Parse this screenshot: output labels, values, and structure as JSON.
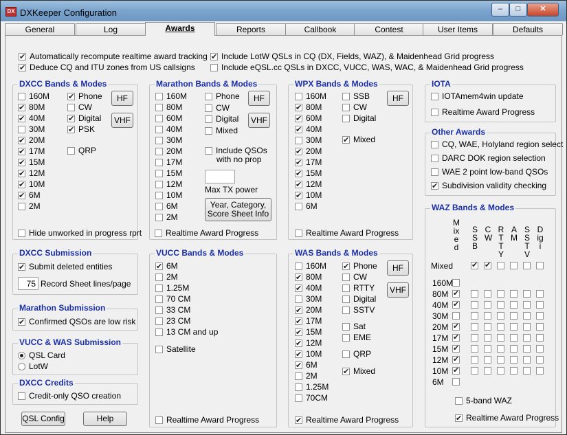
{
  "window": {
    "title": "DXKeeper Configuration"
  },
  "tabs": [
    "General",
    "Log",
    "Awards",
    "Reports",
    "Callbook",
    "Contest",
    "User Items",
    "Defaults"
  ],
  "top_options": {
    "auto_recompute": {
      "label": "Automatically recompute realtime award tracking",
      "checked": true
    },
    "deduce_cq": {
      "label": "Deduce CQ and ITU zones from US callsigns",
      "checked": true
    },
    "include_lotw": {
      "label": "Include LotW QSLs in CQ (DX, Fields, WAZ), & Maidenhead Grid progress",
      "checked": true
    },
    "include_eqsl": {
      "label": "Include eQSL.cc QSLs in DXCC, VUCC, WAS, WAC, & Maidenhead Grid progress",
      "checked": false
    }
  },
  "dxcc_bands": {
    "title": "DXCC Bands & Modes",
    "bands": [
      {
        "label": "160M",
        "checked": false
      },
      {
        "label": "80M",
        "checked": true
      },
      {
        "label": "40M",
        "checked": true
      },
      {
        "label": "30M",
        "checked": false
      },
      {
        "label": "20M",
        "checked": true
      },
      {
        "label": "17M",
        "checked": true
      },
      {
        "label": "15M",
        "checked": true
      },
      {
        "label": "12M",
        "checked": true
      },
      {
        "label": "10M",
        "checked": true
      },
      {
        "label": "6M",
        "checked": true
      },
      {
        "label": "2M",
        "checked": false
      }
    ],
    "modes": [
      {
        "label": "Phone",
        "checked": true
      },
      {
        "label": "CW",
        "checked": false
      },
      {
        "label": "Digital",
        "checked": true
      },
      {
        "label": "PSK",
        "checked": true
      }
    ],
    "qrp": {
      "label": "QRP",
      "checked": false
    },
    "hf": "HF",
    "vhf": "VHF",
    "hide_unworked": {
      "label": "Hide unworked in progress rprt",
      "checked": false
    }
  },
  "marathon_bands": {
    "title": "Marathon Bands & Modes",
    "bands": [
      {
        "label": "160M",
        "checked": false
      },
      {
        "label": "80M",
        "checked": false
      },
      {
        "label": "60M",
        "checked": false
      },
      {
        "label": "40M",
        "checked": false
      },
      {
        "label": "30M",
        "checked": false
      },
      {
        "label": "20M",
        "checked": false
      },
      {
        "label": "17M",
        "checked": false
      },
      {
        "label": "15M",
        "checked": false
      },
      {
        "label": "12M",
        "checked": false
      },
      {
        "label": "10M",
        "checked": false
      },
      {
        "label": "6M",
        "checked": false
      },
      {
        "label": "2M",
        "checked": false
      }
    ],
    "modes": [
      {
        "label": "Phone",
        "checked": false
      },
      {
        "label": "CW",
        "checked": false
      },
      {
        "label": "Digital",
        "checked": false
      },
      {
        "label": "Mixed",
        "checked": false
      }
    ],
    "include_qsos_line1": "Include QSOs",
    "include_qsos_line2": "with no prop",
    "include_qsos_checked": false,
    "max_tx_label": "Max TX power",
    "max_tx_value": "",
    "hf": "HF",
    "vhf": "VHF",
    "score_button_line1": "Year, Category,",
    "score_button_line2": "Score Sheet Info",
    "realtime": {
      "label": "Realtime Award Progress",
      "checked": false
    }
  },
  "wpx_bands": {
    "title": "WPX Bands & Modes",
    "bands": [
      {
        "label": "160M",
        "checked": false
      },
      {
        "label": "80M",
        "checked": true
      },
      {
        "label": "60M",
        "checked": true
      },
      {
        "label": "40M",
        "checked": true
      },
      {
        "label": "30M",
        "checked": false
      },
      {
        "label": "20M",
        "checked": true
      },
      {
        "label": "17M",
        "checked": true
      },
      {
        "label": "15M",
        "checked": true
      },
      {
        "label": "12M",
        "checked": true
      },
      {
        "label": "10M",
        "checked": true
      },
      {
        "label": "6M",
        "checked": false
      }
    ],
    "modes": [
      {
        "label": "SSB",
        "checked": false
      },
      {
        "label": "CW",
        "checked": false
      },
      {
        "label": "Digital",
        "checked": false
      }
    ],
    "mixed": {
      "label": "Mixed",
      "checked": true
    },
    "hf": "HF",
    "realtime": {
      "label": "Realtime Award Progress",
      "checked": false
    }
  },
  "iota": {
    "title": "IOTA",
    "update": {
      "label": "IOTAmem4win update",
      "checked": false
    },
    "realtime": {
      "label": "Realtime Award Progress",
      "checked": false
    }
  },
  "other_awards": {
    "title": "Other Awards",
    "items": [
      {
        "label": "CQ, WAE, Holyland region select",
        "checked": false
      },
      {
        "label": "DARC DOK region selection",
        "checked": false
      },
      {
        "label": "WAE 2 point low-band QSOs",
        "checked": false
      },
      {
        "label": "Subdivision validity checking",
        "checked": true
      }
    ]
  },
  "dxcc_submission": {
    "title": "DXCC Submission",
    "submit_deleted": {
      "label": "Submit deleted entities",
      "checked": true
    },
    "record_lines_value": "75",
    "record_lines_label": "Record Sheet lines/page"
  },
  "marathon_submission": {
    "title": "Marathon Submission",
    "confirmed": {
      "label": "Confirmed QSOs are low risk",
      "checked": true
    }
  },
  "vucc_was_submission": {
    "title": "VUCC & WAS Submission",
    "options": [
      {
        "label": "QSL Card",
        "selected": true
      },
      {
        "label": "LotW",
        "selected": false
      }
    ]
  },
  "dxcc_credits": {
    "title": "DXCC Credits",
    "credit_only": {
      "label": "Credit-only QSO creation",
      "checked": false
    }
  },
  "bottom_buttons": {
    "qsl_config": "QSL Config",
    "help": "Help"
  },
  "vucc_bands": {
    "title": "VUCC Bands & Modes",
    "bands": [
      {
        "label": "6M",
        "checked": true
      },
      {
        "label": "2M",
        "checked": false
      },
      {
        "label": "1.25M",
        "checked": false
      },
      {
        "label": "70 CM",
        "checked": false
      },
      {
        "label": "33 CM",
        "checked": false
      },
      {
        "label": "23 CM",
        "checked": false
      },
      {
        "label": "13 CM and up",
        "checked": false
      }
    ],
    "satellite": {
      "label": "Satellite",
      "checked": false
    },
    "realtime": {
      "label": "Realtime Award Progress",
      "checked": false
    }
  },
  "was_bands": {
    "title": "WAS Bands & Modes",
    "bands": [
      {
        "label": "160M",
        "checked": false
      },
      {
        "label": "80M",
        "checked": true
      },
      {
        "label": "40M",
        "checked": true
      },
      {
        "label": "30M",
        "checked": false
      },
      {
        "label": "20M",
        "checked": true
      },
      {
        "label": "17M",
        "checked": true
      },
      {
        "label": "15M",
        "checked": true
      },
      {
        "label": "12M",
        "checked": true
      },
      {
        "label": "10M",
        "checked": true
      },
      {
        "label": "6M",
        "checked": true
      },
      {
        "label": "2M",
        "checked": false
      },
      {
        "label": "1.25M",
        "checked": false
      },
      {
        "label": "70CM",
        "checked": false
      }
    ],
    "modes": [
      {
        "label": "Phone",
        "checked": true
      },
      {
        "label": "CW",
        "checked": false
      },
      {
        "label": "RTTY",
        "checked": false
      },
      {
        "label": "Digital",
        "checked": false
      },
      {
        "label": "SSTV",
        "checked": false
      }
    ],
    "sat": {
      "label": "Sat",
      "checked": false
    },
    "eme": {
      "label": "EME",
      "checked": false
    },
    "qrp": {
      "label": "QRP",
      "checked": false
    },
    "mixed": {
      "label": "Mixed",
      "checked": true
    },
    "hf": "HF",
    "vhf": "VHF",
    "realtime": {
      "label": "Realtime Award Progress",
      "checked": true
    }
  },
  "waz_bands": {
    "title": "WAZ Bands & Modes",
    "columns": [
      "Mixed",
      "SSB",
      "CW",
      "RTTY",
      "AM",
      "SSTV",
      "Digi"
    ],
    "rows": [
      {
        "label": "Mixed",
        "cells": [
          null,
          true,
          true,
          false,
          false,
          false,
          false
        ]
      },
      {
        "label": "160M",
        "cells": [
          false,
          null,
          null,
          null,
          null,
          null,
          null
        ]
      },
      {
        "label": "80M",
        "cells": [
          true,
          false,
          false,
          false,
          false,
          false,
          false
        ]
      },
      {
        "label": "40M",
        "cells": [
          true,
          false,
          false,
          false,
          false,
          false,
          false
        ]
      },
      {
        "label": "30M",
        "cells": [
          false,
          false,
          false,
          false,
          false,
          false,
          false
        ]
      },
      {
        "label": "20M",
        "cells": [
          true,
          false,
          false,
          false,
          false,
          false,
          false
        ]
      },
      {
        "label": "17M",
        "cells": [
          true,
          false,
          false,
          false,
          false,
          false,
          false
        ]
      },
      {
        "label": "15M",
        "cells": [
          true,
          false,
          false,
          false,
          false,
          false,
          false
        ]
      },
      {
        "label": "12M",
        "cells": [
          true,
          false,
          false,
          false,
          false,
          false,
          false
        ]
      },
      {
        "label": "10M",
        "cells": [
          true,
          false,
          false,
          false,
          false,
          false,
          false
        ]
      },
      {
        "label": "6M",
        "cells": [
          false,
          null,
          null,
          null,
          null,
          null,
          null
        ]
      }
    ],
    "five_band": {
      "label": "5-band WAZ",
      "checked": false
    },
    "realtime": {
      "label": "Realtime Award Progress",
      "checked": true
    }
  }
}
